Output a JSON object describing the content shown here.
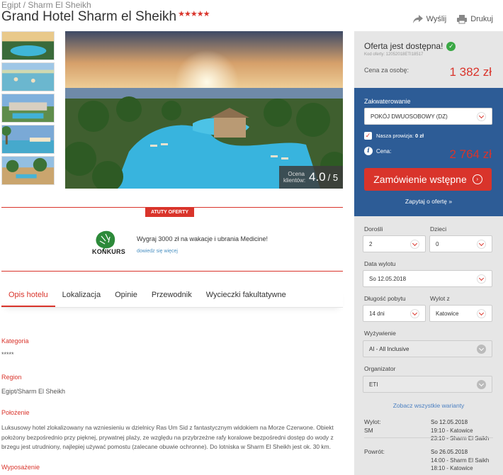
{
  "breadcrumb": "Egipt / Sharm El Sheikh",
  "hotel": {
    "name": "Grand Hotel Sharm el Sheikh",
    "stars": "★★★★★"
  },
  "header_actions": {
    "send": "Wyślij",
    "print": "Drukuj"
  },
  "gallery": {
    "thumb_count": 5,
    "rating_label_line1": "Ocena",
    "rating_label_line2": "klientów:",
    "rating_value": "4.0",
    "rating_max": "/ 5"
  },
  "atuty": {
    "badge": "ATUTY OFERTY",
    "konkurs_label": "KONKURS",
    "promo_text": "Wygraj 3000 zł na wakacje i ubrania Medicine!",
    "promo_link": "dowiedz się więcej"
  },
  "tabs": [
    {
      "label": "Opis hotelu",
      "active": true
    },
    {
      "label": "Lokalizacja",
      "active": false
    },
    {
      "label": "Opinie",
      "active": false
    },
    {
      "label": "Przewodnik",
      "active": false
    },
    {
      "label": "Wycieczki fakultatywne",
      "active": false
    }
  ],
  "description": {
    "kategoria_h": "Kategoria",
    "kategoria_v": "*****",
    "region_h": "Region",
    "region_v": "Egipt/Sharm El Sheikh",
    "polozenie_h": "Położenie",
    "polozenie_v": "Luksusowy hotel zlokalizowany na wzniesieniu w dzielnicy Ras Um Sid z fantastycznym widokiem na Morze Czerwone. Obiekt położony bezpośrednio przy pięknej, prywatnej plaży, ze względu na przybrzeżne rafy koralowe bezpośredni dostęp do wody z brzegu jest utrudniony, najlepiej używać pomostu (zalecane obuwie ochronne). Do lotniska w Sharm El Sheikh jest ok. 30 km.",
    "wyposazenie_h": "Wyposażenie"
  },
  "sidebar": {
    "availability": "Oferta jest dostępna!",
    "offer_code": "Kod oferty: 12052018ETI18517",
    "price_per_person_label": "Cena za osobę:",
    "price_per_person": "1 382 zł",
    "accommodation_label": "Zakwaterowanie",
    "accommodation_value": "POKÓJ DWUOSOBOWY (DZ)",
    "commission_label": "Nasza prowizja:",
    "commission_value": "0 zł",
    "total_label": "Cena:",
    "total_value": "2 764 zł",
    "order_button": "Zamówienie wstępne",
    "ask_link": "Zapytaj o ofertę »",
    "adults_label": "Dorośli",
    "adults_value": "2",
    "children_label": "Dzieci",
    "children_value": "0",
    "departure_date_label": "Data wylotu",
    "departure_date_value": "So 12.05.2018",
    "duration_label": "Długość pobytu",
    "duration_value": "14 dni",
    "from_label": "Wylot z",
    "from_value": "Katowice",
    "board_label": "Wyżywienie",
    "board_value": "AI - All Inclusive",
    "organizer_label": "Organizator",
    "organizer_value": "ETI",
    "see_all": "Zobacz wszystkie warianty",
    "outbound_label": "Wylot:",
    "outbound_sub": "SM",
    "outbound_date": "So 12.05.2018",
    "outbound_line1": "19:10 - Katowice",
    "outbound_line2": "23:10 - Sharm El Saikh",
    "return_label": "Powrót:",
    "return_date": "So 26.05.2018",
    "return_line1": "14:00 - Sharm El Saikh",
    "return_line2": "18:10 - Katowice"
  },
  "colors": {
    "accent": "#d9342b",
    "sidebar_blue": "#2d5c96",
    "sidebar_grey": "#e6e6e6",
    "link": "#4a7fc1",
    "ok_green": "#3aa845"
  }
}
